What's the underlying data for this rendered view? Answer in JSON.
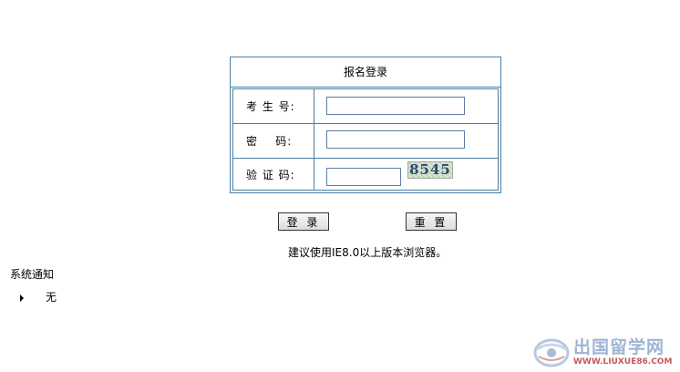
{
  "login": {
    "title": "报名登录",
    "fields": [
      {
        "label": "考 生 号:",
        "value": ""
      },
      {
        "label": "密    码:",
        "value": ""
      },
      {
        "label": "验 证 码:",
        "value": ""
      }
    ],
    "captcha_text": "8545",
    "login_button": "登 录",
    "reset_button": "重 置"
  },
  "hint": "建议使用IE8.0以上版本浏览器。",
  "notices": {
    "title": "系统通知",
    "items": [
      "无"
    ]
  },
  "watermark": {
    "name": "出国留学网",
    "url": "WWW.LIUXUE86.COM"
  },
  "colors": {
    "border": "#4a7fa6",
    "input_border": "#5b7fa8"
  }
}
